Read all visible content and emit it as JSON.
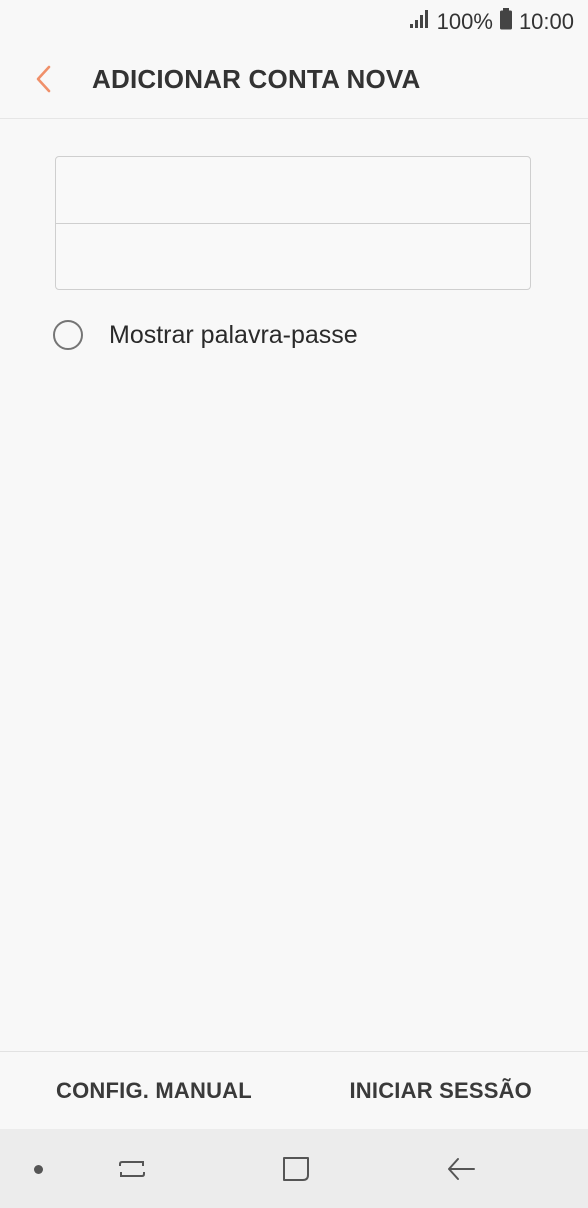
{
  "status_bar": {
    "battery": "100%",
    "time": "10:00",
    "icons": [
      "signal-icon",
      "battery-icon"
    ]
  },
  "header": {
    "title": "ADICIONAR CONTA NOVA",
    "back_icon": "chevron-left-icon",
    "accent_color": "#f0906a"
  },
  "form": {
    "email_value": "",
    "password_value": ""
  },
  "show_password": {
    "label": "Mostrar palavra-passe",
    "checked": false
  },
  "actions": {
    "manual_label": "CONFIG. MANUAL",
    "signin_label": "INICIAR SESSÃO"
  },
  "nav_bar": {
    "items": [
      "dot-indicator-icon",
      "recent-apps-icon",
      "home-icon",
      "back-icon"
    ]
  }
}
